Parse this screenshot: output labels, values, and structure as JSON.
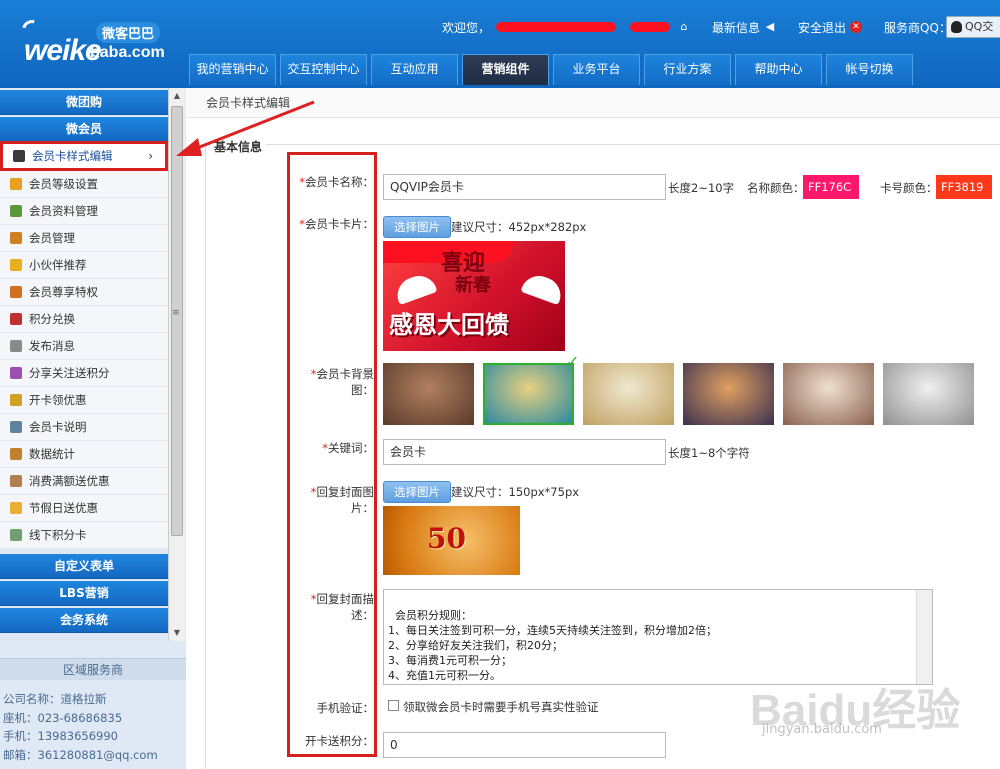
{
  "header": {
    "logo": {
      "cn": "微客巴巴",
      "brand_a": "weike",
      "brand_b": "baba.com"
    },
    "welcome": "欢迎您，",
    "news": "最新信息",
    "logout": "安全退出",
    "service_qq": "服务商QQ：",
    "qq_button": "QQ交"
  },
  "nav": {
    "tabs": [
      {
        "label": "我的营销中心",
        "active": false
      },
      {
        "label": "交互控制中心",
        "active": false
      },
      {
        "label": "互动应用",
        "active": false
      },
      {
        "label": "营销组件",
        "active": true
      },
      {
        "label": "业务平台",
        "active": false
      },
      {
        "label": "行业方案",
        "active": false
      },
      {
        "label": "帮助中心",
        "active": false
      },
      {
        "label": "帐号切换",
        "active": false
      }
    ]
  },
  "sidebar": {
    "categories": [
      "微团购",
      "微会员",
      "自定义表单",
      "LBS营销",
      "会务系统"
    ],
    "items": [
      {
        "label": "会员卡样式编辑",
        "icon": "grid-icon",
        "color": "#3a3a3a",
        "active": true
      },
      {
        "label": "会员等级设置",
        "icon": "medal-icon",
        "color": "#e8a020"
      },
      {
        "label": "会员资料管理",
        "icon": "profile-card-icon",
        "color": "#5a9a3a"
      },
      {
        "label": "会员管理",
        "icon": "users-icon",
        "color": "#d08020"
      },
      {
        "label": "小伙伴推荐",
        "icon": "chat-icon",
        "color": "#e8b020"
      },
      {
        "label": "会员尊享特权",
        "icon": "vip-user-icon",
        "color": "#d07020"
      },
      {
        "label": "积分兑换",
        "icon": "points-icon",
        "color": "#c03030"
      },
      {
        "label": "发布消息",
        "icon": "edit-icon",
        "color": "#8a8a8a"
      },
      {
        "label": "分享关注送积分",
        "icon": "share-icon",
        "color": "#9a50b0"
      },
      {
        "label": "开卡领优惠",
        "icon": "unlock-icon",
        "color": "#d0a020"
      },
      {
        "label": "会员卡说明",
        "icon": "document-icon",
        "color": "#6080a0"
      },
      {
        "label": "数据统计",
        "icon": "stats-icon",
        "color": "#c08030"
      },
      {
        "label": "消费满额送优惠",
        "icon": "receipt-icon",
        "color": "#b08050"
      },
      {
        "label": "节假日送优惠",
        "icon": "holiday-icon",
        "color": "#e8b030"
      },
      {
        "label": "线下积分卡",
        "icon": "card-icon",
        "color": "#70a070"
      }
    ],
    "region": "区域服务商",
    "contact": {
      "company": "公司名称：道格拉斯",
      "phone": "座机：023-68686835",
      "mobile": "手机：13983656990",
      "email": "邮箱：361280881@qq.com"
    }
  },
  "main": {
    "breadcrumb": "会员卡样式编辑",
    "section_title": "基本信息",
    "fields": {
      "card_name": {
        "label": "会员卡名称：",
        "value": "QQVIP会员卡",
        "hint": "长度2~10字"
      },
      "name_color": {
        "label": "名称颜色：",
        "value": "FF176C",
        "color": "#FF176C"
      },
      "number_color": {
        "label": "卡号颜色：",
        "value": "FF3819",
        "color": "#FF3819"
      },
      "card_image": {
        "label": "会员卡卡片：",
        "button": "选择图片",
        "hint": "建议尺寸：452px*282px"
      },
      "card_bg": {
        "label": "会员卡背景图："
      },
      "keyword": {
        "label": "关键词：",
        "value": "会员卡",
        "hint": "长度1~8个字符"
      },
      "cover_image": {
        "label": "回复封面图片：",
        "button": "选择图片",
        "hint": "建议尺寸：150px*75px"
      },
      "cover_desc": {
        "label": "回复封面描述：",
        "value": "会员积分规则：\n1、每日关注签到可积一分，连续5天持续关注签到，积分增加2倍；\n2、分享给好友关注我们，积20分；\n3、每消费1元可积一分；\n4、充值1元可积一分。\n\n积分兑换规则："
      },
      "phone_verify": {
        "label": "手机验证：",
        "checkbox_label": "领取微会员卡时需要手机号真实性验证",
        "checked": false
      },
      "open_points": {
        "label": "开卡送积分：",
        "value": "0"
      }
    },
    "card_image_text": {
      "line1": "喜迎",
      "line2": "新春",
      "line3": "感恩大回馈"
    },
    "cover_image_text": "50",
    "backgrounds": [
      {
        "colors": [
          "#5a3a2a",
          "#b08060"
        ],
        "selected": false
      },
      {
        "colors": [
          "#2a8aa0",
          "#e8d080"
        ],
        "selected": true
      },
      {
        "colors": [
          "#c0a060",
          "#f0e8d0"
        ],
        "selected": false
      },
      {
        "colors": [
          "#3a3050",
          "#e0a060"
        ],
        "selected": false
      },
      {
        "colors": [
          "#8a6050",
          "#f0e0d0"
        ],
        "selected": false
      },
      {
        "colors": [
          "#909090",
          "#f0f0f0"
        ],
        "selected": false
      }
    ]
  },
  "watermark": {
    "brand": "Baidu经验",
    "url": "jingyan.baidu.com"
  }
}
